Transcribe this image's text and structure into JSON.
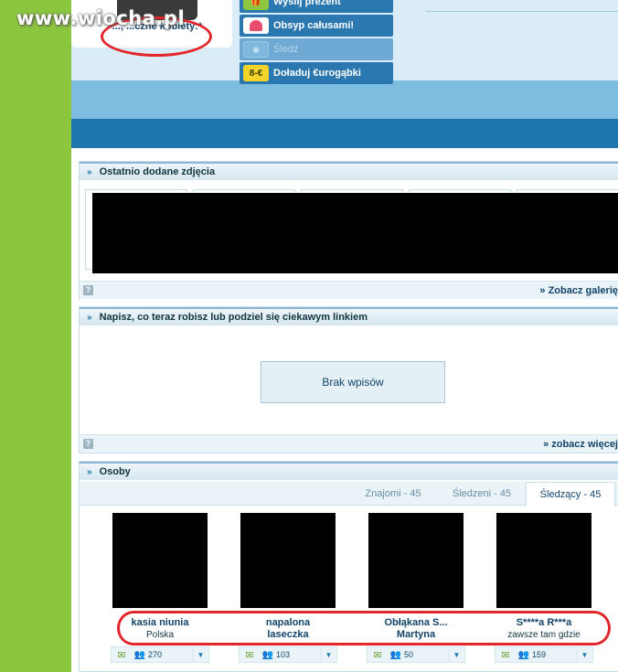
{
  "watermark": "www.wiocha.pl",
  "profile": {
    "caption": "..., ...czne kobiety:*"
  },
  "actions": [
    {
      "label": "Wyślij prezent",
      "icon": "gift-icon",
      "enabled": true
    },
    {
      "label": "Obsyp całusami!",
      "icon": "lips-icon",
      "enabled": true
    },
    {
      "label": "Śledź",
      "icon": "eye-icon",
      "enabled": false
    },
    {
      "label": "Doładuj €urogąbki",
      "icon": "euro-coins-icon",
      "enabled": true
    }
  ],
  "photos_section": {
    "title": "Ostatnio dodane zdjęcia",
    "footer_link": "» Zobacz galerię",
    "help": "?"
  },
  "status_section": {
    "title": "Napisz, co teraz robisz lub podziel się ciekawym linkiem",
    "empty_label": "Brak wpisów",
    "footer_link": "» zobacz więcej",
    "help": "?"
  },
  "people_section": {
    "title": "Osoby",
    "tabs": [
      {
        "label": "Znajomi - 45",
        "active": false
      },
      {
        "label": "Śledzeni - 45",
        "active": false
      },
      {
        "label": "Śledzący - 45",
        "active": true
      }
    ],
    "people": [
      {
        "name": "kasia niunia",
        "sub": "Polska",
        "sub_bold": false,
        "friends": "270"
      },
      {
        "name": "napalona",
        "sub": "laseczka",
        "sub_bold": true,
        "friends": "103"
      },
      {
        "name": "Obłąkana S...",
        "sub": "Martyna",
        "sub_bold": true,
        "friends": "50"
      },
      {
        "name": "S****a R***a",
        "sub": "zawsze tam gdzie",
        "sub_bold": false,
        "friends": "159"
      }
    ]
  },
  "colors": {
    "rail": "#8cc63f",
    "accent": "#1e77ac",
    "highlight": "#e3262b"
  }
}
